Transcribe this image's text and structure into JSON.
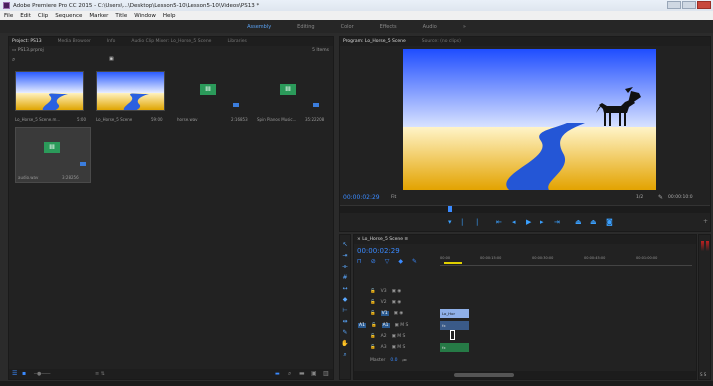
{
  "window": {
    "title": "Adobe Premiere Pro CC 2015 - C:\\Users\\...\\Desktop\\Lesson5-10\\Lesson5-10\\Videos\\PS13 *"
  },
  "menu": [
    "File",
    "Edit",
    "Clip",
    "Sequence",
    "Marker",
    "Title",
    "Window",
    "Help"
  ],
  "workspaces": [
    "Assembly",
    "Editing",
    "Color",
    "Effects",
    "Audio"
  ],
  "project_panel": {
    "tabs": [
      "Project: PS13",
      "Media Browser",
      "Info",
      "Audio Clip Mixer: Lo_Horse_5 Scene",
      "Libraries"
    ],
    "path": "PS13.prproj",
    "count": "5 Items",
    "items": [
      {
        "name": "Lo_Horse_5 Scene.m...",
        "duration": "5:00"
      },
      {
        "name": "Lo_Horse_5 Scene",
        "duration": "59:00"
      },
      {
        "name": "horse.wav",
        "duration": "2:16853"
      },
      {
        "name": "Spin Pianos Music...",
        "duration": "35:22208"
      },
      {
        "name": "audio.wav",
        "duration": "3:28256"
      }
    ]
  },
  "program_monitor": {
    "tabs": [
      "Program: Lo_Horse_5 Scene",
      "Source: (no clips)"
    ],
    "timecode": "00:00:02:29",
    "fit": "Fit",
    "quality": "1/2",
    "end_timecode": "00:00:10:0"
  },
  "timeline": {
    "sequence_tab": "Lo_Horse_5 Scene",
    "timecode": "00:00:02:29",
    "ruler": [
      "00:00",
      "00:00:15:00",
      "00:00:30:00",
      "00:00:45:00",
      "00:01:00:00"
    ],
    "tracks": [
      {
        "name": "V3"
      },
      {
        "name": "V2"
      },
      {
        "name": "V1"
      },
      {
        "name": "A1"
      },
      {
        "name": "A2"
      },
      {
        "name": "A3"
      }
    ],
    "master": {
      "label": "Master",
      "value": "0.0"
    },
    "clip_label": "Lo_Hor"
  }
}
